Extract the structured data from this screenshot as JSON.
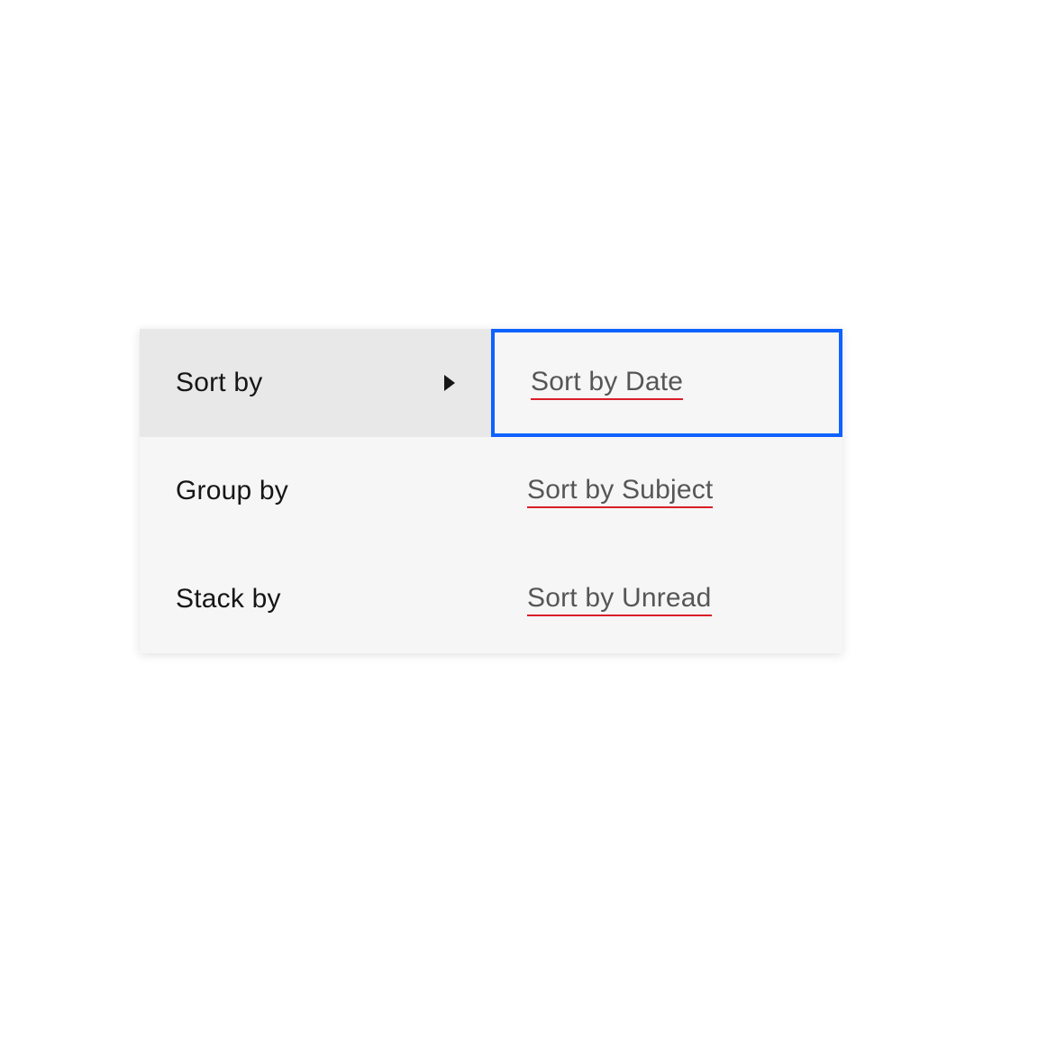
{
  "menu": {
    "items": [
      {
        "label": "Sort by",
        "hasSubmenu": true,
        "active": true
      },
      {
        "label": "Group by",
        "hasSubmenu": false,
        "active": false
      },
      {
        "label": "Stack by",
        "hasSubmenu": false,
        "active": false
      }
    ]
  },
  "submenu": {
    "items": [
      {
        "label": "Sort by Date",
        "focused": true
      },
      {
        "label": "Sort by Subject",
        "focused": false
      },
      {
        "label": "Sort by Unread",
        "focused": false
      }
    ]
  },
  "colors": {
    "focusBorder": "#0f62fe",
    "underline": "#da1e28",
    "menuBg": "#f6f6f6",
    "activeBg": "#e8e8e8",
    "primaryText": "#161616",
    "submenuText": "#565656"
  }
}
